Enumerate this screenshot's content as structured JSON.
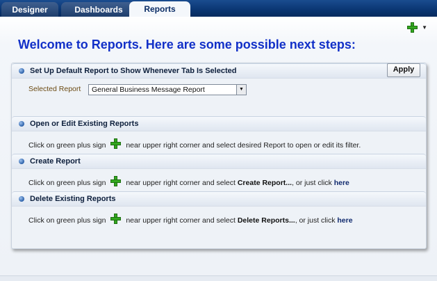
{
  "tabs": [
    {
      "label": "Designer"
    },
    {
      "label": "Dashboards"
    },
    {
      "label": "Reports"
    }
  ],
  "welcome": "Welcome to Reports.  Here are some possible next steps:",
  "toolbar": {
    "add_icon": "plus-icon",
    "menu_icon": "chevron-down-icon",
    "caret": "▼"
  },
  "sections": {
    "default_report": {
      "title": "Set Up Default Report to Show Whenever Tab Is Selected",
      "apply_label": "Apply",
      "selected_label": "Selected Report",
      "selected_value": "General Business Message Report"
    },
    "open_edit": {
      "title": "Open or Edit Existing Reports",
      "text_before": "Click on green plus sign",
      "text_after": "near upper right corner and select desired Report to open or edit its filter."
    },
    "create": {
      "title": "Create Report",
      "text_before": "Click on green plus sign",
      "text_mid": "near upper right corner and select",
      "action": "Create Report...",
      "text_or": ", or just click",
      "link": "here"
    },
    "delete": {
      "title": "Delete Existing Reports",
      "text_before": "Click on green plus sign",
      "text_mid": "near upper right corner and select",
      "action": "Delete Reports...",
      "text_or": ", or just click",
      "link": "here"
    }
  },
  "colors": {
    "title_blue": "#1230c8",
    "tab_bar": "#0b3774",
    "plus_green": "#33a81f"
  }
}
